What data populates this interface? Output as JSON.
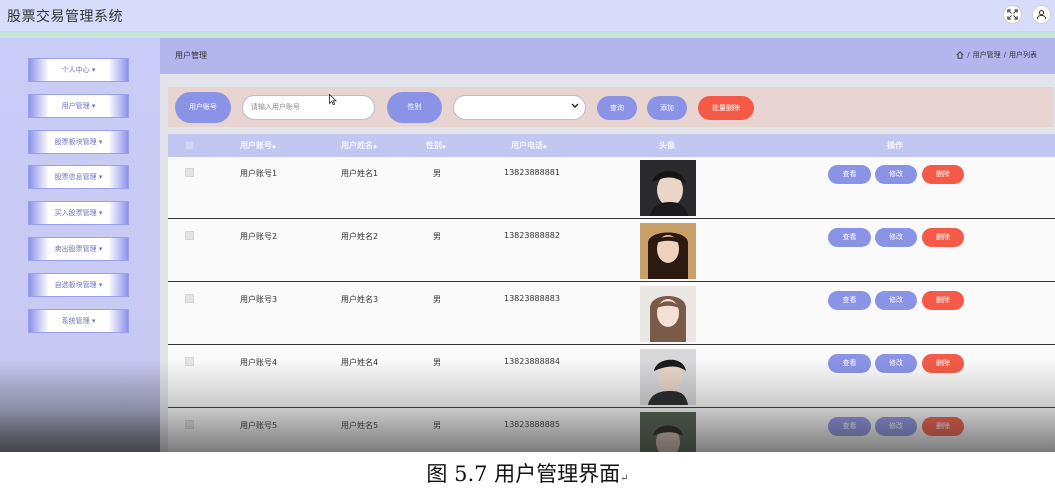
{
  "app": {
    "title": "股票交易管理系统",
    "fullscreen_icon": "fullscreen-icon",
    "user_icon": "user-icon"
  },
  "sidebar": {
    "items": [
      {
        "label": "个人中心"
      },
      {
        "label": "用户管理"
      },
      {
        "label": "股票板块管理"
      },
      {
        "label": "股票信息管理"
      },
      {
        "label": "买入股票管理"
      },
      {
        "label": "卖出股票管理"
      },
      {
        "label": "自选板块管理"
      },
      {
        "label": "系统管理"
      }
    ],
    "caret": "▾"
  },
  "header": {
    "title": "用户管理",
    "breadcrumb": {
      "home_icon": "home-icon",
      "sep": "/",
      "level1": "用户管理",
      "level2": "用户列表"
    }
  },
  "search": {
    "account_label": "用户账号",
    "account_placeholder": "请输入用户账号",
    "gender_label": "性别",
    "gender_value": "",
    "query_button": "查询",
    "add_button": "添加",
    "batch_delete_button": "批量删除"
  },
  "table": {
    "columns": [
      "用户账号",
      "用户姓名",
      "性别",
      "用户电话",
      "头像",
      "操作"
    ],
    "sort_mark": "◆",
    "rows": [
      {
        "account": "用户账号1",
        "name": "用户姓名1",
        "gender": "男",
        "phone": "13823888881"
      },
      {
        "account": "用户账号2",
        "name": "用户姓名2",
        "gender": "男",
        "phone": "13823888882"
      },
      {
        "account": "用户账号3",
        "name": "用户姓名3",
        "gender": "男",
        "phone": "13823888883"
      },
      {
        "account": "用户账号4",
        "name": "用户姓名4",
        "gender": "男",
        "phone": "13823888884"
      },
      {
        "account": "用户账号5",
        "name": "用户姓名5",
        "gender": "男",
        "phone": "13823888885"
      }
    ],
    "actions": {
      "view": "查看",
      "edit": "修改",
      "delete": "删除"
    }
  },
  "colors": {
    "accent": "#8b93e6",
    "danger": "#f45a47",
    "header_bar": "#b3b6ec",
    "sidebar": "#c9ccf6"
  },
  "caption": {
    "text": "图  5.7  用户管理界面",
    "mark": "↵"
  }
}
